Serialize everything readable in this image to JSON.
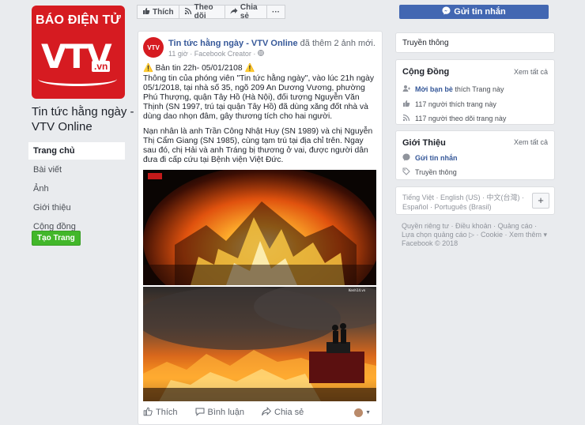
{
  "page": {
    "logo_line1": "BÁO ĐIỆN TỬ",
    "logo_line2": "VTV",
    "logo_suffix": ".vn",
    "name_line1": "Tin tức hằng ngày -",
    "name_line2": "VTV Online"
  },
  "nav": [
    "Trang chủ",
    "Bài viết",
    "Ảnh",
    "Giới thiệu",
    "Cộng đồng"
  ],
  "create_page": "Tạo Trang",
  "actionbar": {
    "like": "Thích",
    "follow": "Theo dõi",
    "share": "Chia sẻ",
    "more": "···",
    "message": "Gửi tin nhắn"
  },
  "post": {
    "author": "Tin tức hằng ngày - VTV Online",
    "added": "đã thêm 2 ảnh mới.",
    "time": "11 giờ",
    "sep": "·",
    "creator": "Facebook Creator",
    "p1_line": "⚠️ Bản tin 22h- 05/01/2108 ⚠️",
    "p1": "Thông tin của phóng viên \"Tin tức hằng ngày\", vào lúc 21h ngày 05/1/2018, tại nhà số 35, ngõ 209 An Dương Vương, phường Phú Thượng, quận Tây Hồ (Hà Nội), đối tượng Nguyễn Văn Thịnh (SN 1997, trú tại quận Tây Hồ) đã dùng xăng đốt nhà và dùng dao nhọn đâm, gây thương tích cho hai người.",
    "p2": "Nạn nhân là anh Trần Công Nhật Huy (SN 1989) và chị Nguyễn Thị Cẩm Giang (SN 1985), cùng tạm trú tại địa chỉ trên. Ngay sau đó, chị Hải và anh Tráng bị thương ở vai, được người dân đưa đi cấp cứu tại Bệnh viện Việt Đức.",
    "like": "Thích",
    "comment": "Bình luận",
    "share": "Chia sẻ"
  },
  "right": {
    "category": "Truyền thông",
    "community_title": "Cộng Đồng",
    "see_all": "Xem tất cả",
    "invite_bold": "Mời bạn bè",
    "invite_rest": "thích Trang này",
    "likes": "117 người thích trang này",
    "follows": "117 người theo dõi trang này",
    "about_title": "Giới Thiệu",
    "about_send": "Gửi tin nhắn",
    "about_cat": "Truyền thông",
    "lang_line1": "Tiếng Việt · English (US) · 中文(台灣) ·",
    "lang_line2": "Español · Português (Brasil)",
    "plus": "+",
    "footer_line1": "Quyền riêng tư · Điều khoản · Quảng cáo ·",
    "footer_line2": "Lựa chọn quảng cáo ▷ · Cookie · Xem thêm ▾",
    "footer_line3": "Facebook © 2018"
  },
  "colors": {
    "brand_red": "#d61b21",
    "fb_blue": "#4267b2",
    "link": "#365899",
    "green": "#42b72a"
  }
}
